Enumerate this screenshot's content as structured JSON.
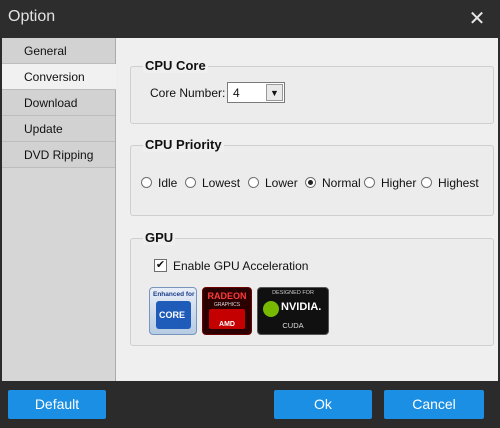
{
  "window": {
    "title": "Option"
  },
  "sidebar": {
    "items": [
      {
        "label": "General"
      },
      {
        "label": "Conversion"
      },
      {
        "label": "Download"
      },
      {
        "label": "Update"
      },
      {
        "label": "DVD Ripping"
      }
    ],
    "active_index": 1
  },
  "cpu_core": {
    "title": "CPU Core",
    "label": "Core Number:",
    "value": "4"
  },
  "cpu_priority": {
    "title": "CPU Priority",
    "options": [
      "Idle",
      "Lowest",
      "Lower",
      "Normal",
      "Higher",
      "Highest"
    ],
    "selected": "Normal"
  },
  "gpu": {
    "title": "GPU",
    "checkbox_label": "Enable GPU Acceleration",
    "checked": true,
    "logos": {
      "intel": {
        "top": "Enhanced for",
        "core": "CORE"
      },
      "amd": {
        "radeon": "RADEON",
        "graphics": "GRAPHICS",
        "brand": "AMD"
      },
      "nvidia": {
        "designed": "DESIGNED FOR",
        "name": "NVIDIA.",
        "cuda": "CUDA"
      }
    }
  },
  "footer": {
    "default_label": "Default",
    "ok_label": "Ok",
    "cancel_label": "Cancel"
  },
  "colors": {
    "accent": "#1b8fe4",
    "titlebar": "#2d2d2d"
  }
}
